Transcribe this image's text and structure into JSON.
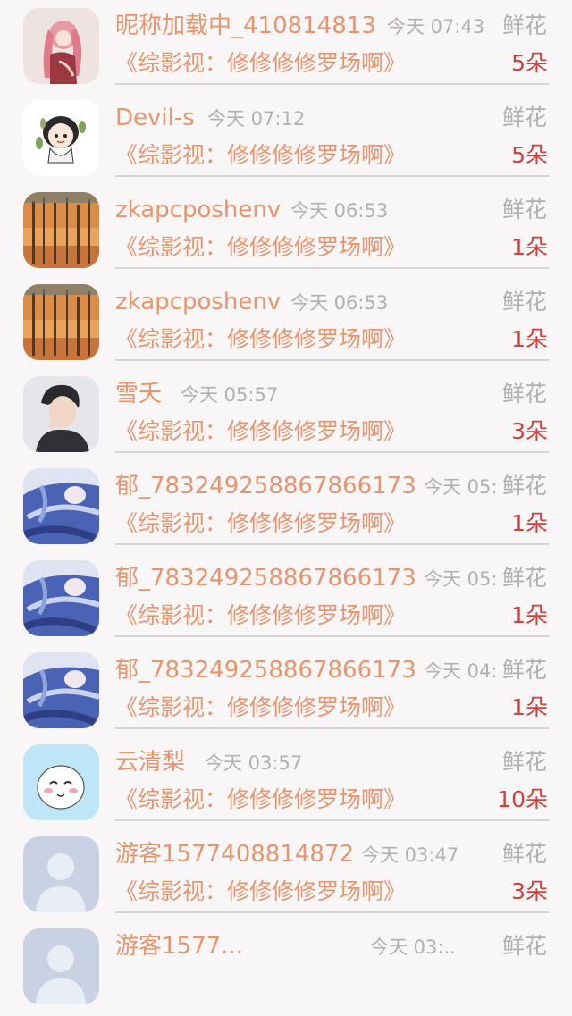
{
  "colors": {
    "background": "#f8f6f7",
    "name_text": "#e8956e",
    "meta_text": "#b3b0b2",
    "count_text": "#d2423c",
    "divider": "#d6d3d5"
  },
  "rows": [
    {
      "avatar": "anime-girl-avatar",
      "name": "昵称加载中_410814813",
      "time": "今天 07:43",
      "gift": "鲜花",
      "book": "《综影视：修修修修罗场啊》",
      "count": "5朵"
    },
    {
      "avatar": "cartoon-girl-avatar",
      "name": "Devil-s",
      "time": "今天 07:12",
      "gift": "鲜花",
      "book": "《综影视：修修修修罗场啊》",
      "count": "5朵"
    },
    {
      "avatar": "autumn-forest-avatar",
      "name": "zkapcposhenv",
      "time": "今天 06:53",
      "gift": "鲜花",
      "book": "《综影视：修修修修罗场啊》",
      "count": "1朵"
    },
    {
      "avatar": "autumn-forest-avatar",
      "name": "zkapcposhenv",
      "time": "今天 06:53",
      "gift": "鲜花",
      "book": "《综影视：修修修修罗场啊》",
      "count": "1朵"
    },
    {
      "avatar": "man-portrait-avatar",
      "name": "雪夭",
      "time": "今天 05:57",
      "gift": "鲜花",
      "book": "《综影视：修修修修罗场啊》",
      "count": "3朵"
    },
    {
      "avatar": "blue-anime-avatar",
      "name": "郁_783249258867866173",
      "time": "今天 05:",
      "gift": "鲜花",
      "book": "《综影视：修修修修罗场啊》",
      "count": "1朵"
    },
    {
      "avatar": "blue-anime-avatar",
      "name": "郁_783249258867866173",
      "time": "今天 05:",
      "gift": "鲜花",
      "book": "《综影视：修修修修罗场啊》",
      "count": "1朵"
    },
    {
      "avatar": "blue-anime-avatar",
      "name": "郁_783249258867866173",
      "time": "今天 04:",
      "gift": "鲜花",
      "book": "《综影视：修修修修罗场啊》",
      "count": "1朵"
    },
    {
      "avatar": "smiley-cartoon-avatar",
      "name": "云清梨",
      "time": "今天 03:57",
      "gift": "鲜花",
      "book": "《综影视：修修修修罗场啊》",
      "count": "10朵"
    },
    {
      "avatar": "default-user-avatar",
      "name": "游客1577408814872",
      "time": "今天 03:47",
      "gift": "鲜花",
      "book": "《综影视：修修修修罗场啊》",
      "count": "3朵"
    },
    {
      "avatar": "default-user-avatar",
      "name": "游客1577...",
      "time": "今天 03:..",
      "gift": "鲜花",
      "book": "",
      "count": ""
    }
  ]
}
